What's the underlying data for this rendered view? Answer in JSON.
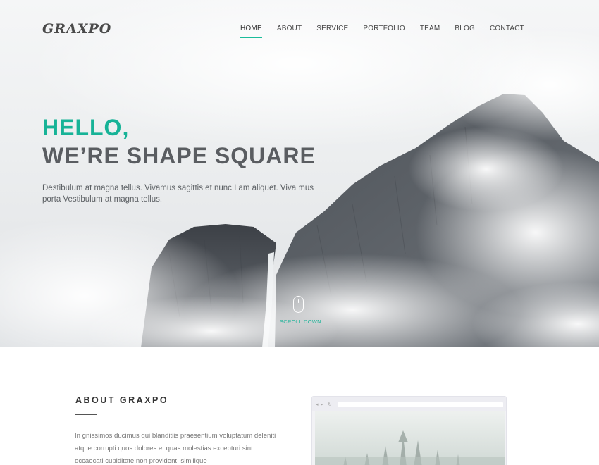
{
  "header": {
    "logo": "GRAXPO",
    "nav": [
      "HOME",
      "ABOUT",
      "SERVICE",
      "PORTFOLIO",
      "TEAM",
      "BLOG",
      "CONTACT"
    ],
    "active_nav": "HOME"
  },
  "hero": {
    "greeting": "HELLO,",
    "headline": "WE’RE SHAPE SQUARE",
    "intro": "Destibulum at magna tellus. Vivamus sagittis et nunc I am aliquet. Viva mus porta Vestibulum at magna tellus.",
    "scroll_label": "SCROLL DOWN"
  },
  "about": {
    "title": "ABOUT GRAXPO",
    "text": "In gnissimos ducimus qui blanditiis praesentium voluptatum deleniti atque corrupti quos dolores et quas molestias excepturi sint occaecati cupiditate non provident, similique"
  },
  "colors": {
    "accent": "#17b397",
    "heading": "#5a5d61"
  }
}
